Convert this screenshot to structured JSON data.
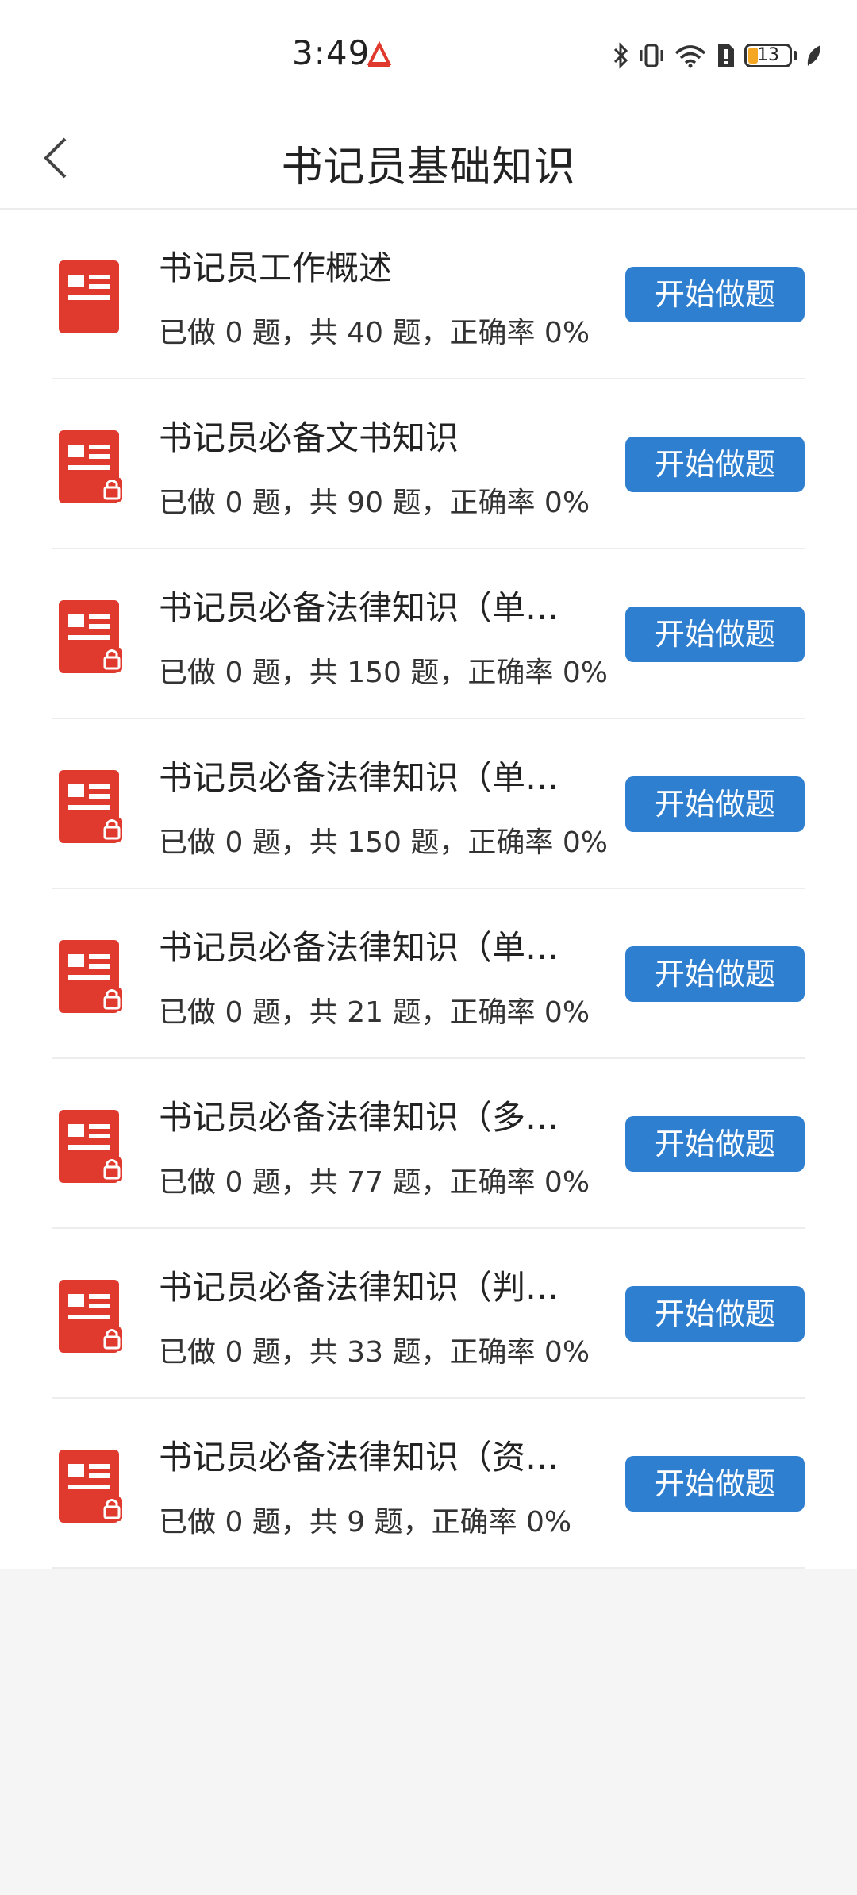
{
  "status_bar": {
    "time": "3:49",
    "battery_level": "13"
  },
  "header": {
    "title": "书记员基础知识"
  },
  "colors": {
    "accent": "#2f7fd1",
    "icon_red": "#e03a2f"
  },
  "items": [
    {
      "title": "书记员工作概述",
      "progress": "已做 0 题，共 40 题，正确率 0%",
      "button": "开始做题",
      "locked": false
    },
    {
      "title": "书记员必备文书知识",
      "progress": "已做 0 题，共 90 题，正确率 0%",
      "button": "开始做题",
      "locked": true
    },
    {
      "title": "书记员必备法律知识（单…",
      "progress": "已做 0 题，共 150 题，正确率 0%",
      "button": "开始做题",
      "locked": true
    },
    {
      "title": "书记员必备法律知识（单…",
      "progress": "已做 0 题，共 150 题，正确率 0%",
      "button": "开始做题",
      "locked": true
    },
    {
      "title": "书记员必备法律知识（单…",
      "progress": "已做 0 题，共 21 题，正确率 0%",
      "button": "开始做题",
      "locked": true
    },
    {
      "title": "书记员必备法律知识（多…",
      "progress": "已做 0 题，共 77 题，正确率 0%",
      "button": "开始做题",
      "locked": true
    },
    {
      "title": "书记员必备法律知识（判…",
      "progress": "已做 0 题，共 33 题，正确率 0%",
      "button": "开始做题",
      "locked": true
    },
    {
      "title": "书记员必备法律知识（资…",
      "progress": "已做 0 题，共 9 题，正确率 0%",
      "button": "开始做题",
      "locked": true
    }
  ]
}
